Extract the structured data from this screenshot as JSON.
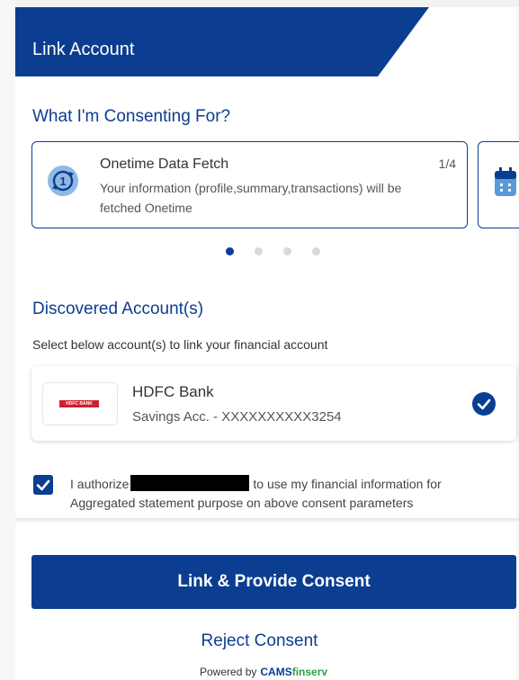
{
  "header": {
    "title": "Link Account"
  },
  "consent": {
    "title": "What I'm Consenting For?",
    "cards": [
      {
        "title": "Onetime Data Fetch",
        "description": "Your information (profile,summary,transactions) will be fetched Onetime",
        "count": "1/4",
        "icon": "refresh-one-icon"
      },
      {
        "icon": "calendar-icon"
      }
    ],
    "active_page": 1,
    "page_total": 4
  },
  "discovered": {
    "title": "Discovered Account(s)",
    "helper": "Select below account(s) to link your financial account",
    "account": {
      "logo_text": "HDFC BANK",
      "bank": "HDFC Bank",
      "info": "Savings Acc. - XXXXXXXXXX3254",
      "selected": true
    }
  },
  "authorization": {
    "prefix": "I authorize",
    "suffix": "to use my financial information for Aggregated statement purpose on above consent parameters",
    "checked": true
  },
  "actions": {
    "primary": "Link & Provide Consent",
    "reject": "Reject Consent"
  },
  "footer": {
    "powered_by": "Powered by",
    "brand_main": "CAMS",
    "brand_accent": "finserv"
  },
  "colors": {
    "brand": "#0b3d91",
    "accent_green": "#2aa046",
    "logo_red": "#cc1f2f"
  }
}
